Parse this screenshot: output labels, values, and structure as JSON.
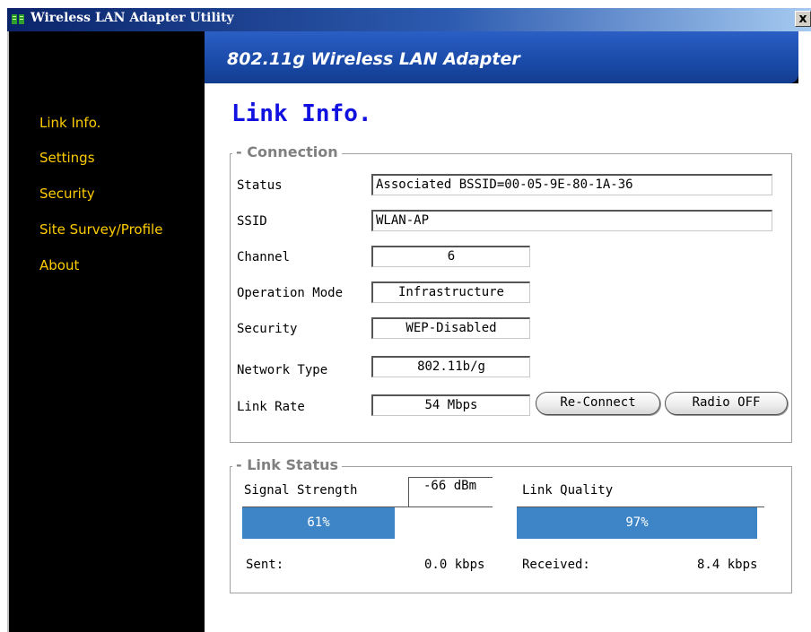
{
  "window": {
    "title": "Wireless LAN Adapter Utility",
    "close_glyph": "x"
  },
  "header": {
    "title": "802.11g Wireless LAN Adapter"
  },
  "sidebar": {
    "items": [
      {
        "label": "Link Info."
      },
      {
        "label": "Settings"
      },
      {
        "label": "Security"
      },
      {
        "label": "Site Survey/Profile"
      },
      {
        "label": "About"
      }
    ]
  },
  "page": {
    "title": "Link Info."
  },
  "connection": {
    "legend": "Connection",
    "status_label": "Status",
    "status_value": "Associated BSSID=00-05-9E-80-1A-36",
    "ssid_label": "SSID",
    "ssid_value": "WLAN-AP",
    "channel_label": "Channel",
    "channel_value": "6",
    "mode_label": "Operation Mode",
    "mode_value": "Infrastructure",
    "security_label": "Security",
    "security_value": "WEP-Disabled",
    "network_label": "Network Type",
    "network_value": "802.11b/g",
    "rate_label": "Link Rate",
    "rate_value": "54 Mbps",
    "reconnect_label": "Re-Connect",
    "radio_label": "Radio OFF"
  },
  "link_status": {
    "legend": "Link Status",
    "signal_label": "Signal Strength",
    "signal_value": "-66 dBm",
    "signal_percent_text": "61%",
    "signal_fraction": 0.61,
    "quality_label": "Link Quality",
    "quality_percent_text": "97%",
    "quality_fraction": 0.97,
    "sent_label": "Sent:",
    "sent_value": "0.0 kbps",
    "received_label": "Received:",
    "received_value": "8.4 kbps"
  },
  "colors": {
    "accent_nav": "#ffcc00",
    "title_blue": "#1010e0",
    "bar_blue": "#3d85c6",
    "header_blue": "#1a4aa8"
  }
}
